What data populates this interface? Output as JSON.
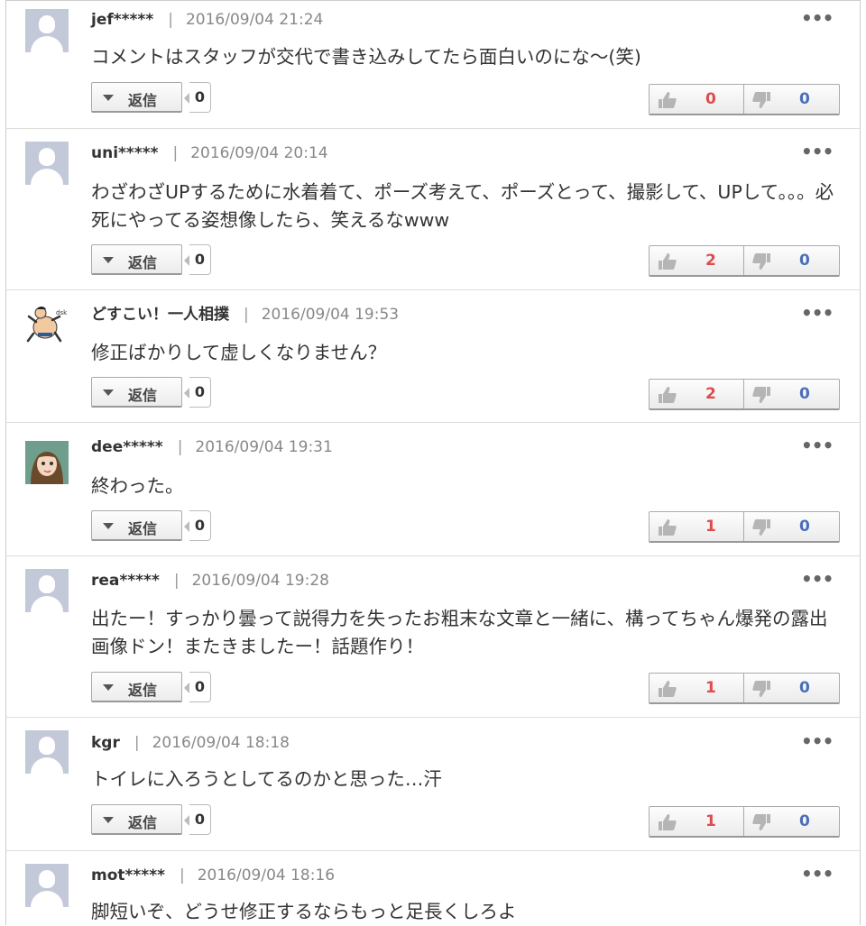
{
  "reply_label": "返信",
  "menu_label": "•••",
  "separator": "|",
  "colors": {
    "good": "#e04b4b",
    "bad": "#4a6fb8"
  },
  "comments": [
    {
      "name": "jef*****",
      "date": "2016/09/04 21:24",
      "avatar": "default-avatar-icon",
      "body": "コメントはスタッフが交代で書き込みしてたら面白いのにな～(笑)",
      "replies": "0",
      "good": "0",
      "bad": "0"
    },
    {
      "name": "uni*****",
      "date": "2016/09/04 20:14",
      "avatar": "default-avatar-icon",
      "body": "わざわざUPするために水着着て、ポーズ考えて、ポーズとって、撮影して、UPして。。。必死にやってる姿想像したら、笑えるなwww",
      "replies": "0",
      "good": "2",
      "bad": "0"
    },
    {
      "name": "どすこい！一人相撲",
      "date": "2016/09/04 19:53",
      "avatar": "sumo-avatar-icon",
      "body": "修正ばかりして虚しくなりません？",
      "replies": "0",
      "good": "2",
      "bad": "0"
    },
    {
      "name": "dee*****",
      "date": "2016/09/04 19:31",
      "avatar": "anime-avatar-icon",
      "body": "終わった。",
      "replies": "0",
      "good": "1",
      "bad": "0"
    },
    {
      "name": "rea*****",
      "date": "2016/09/04 19:28",
      "avatar": "default-avatar-icon",
      "body": "出たー！すっかり曇って説得力を失ったお粗末な文章と一緒に、構ってちゃん爆発の露出画像ドン！またきましたー！話題作り！",
      "replies": "0",
      "good": "1",
      "bad": "0"
    },
    {
      "name": "kgr",
      "date": "2016/09/04 18:18",
      "avatar": "default-avatar-icon",
      "body": "トイレに入ろうとしてるのかと思った…汗",
      "replies": "0",
      "good": "1",
      "bad": "0"
    },
    {
      "name": "mot*****",
      "date": "2016/09/04 18:16",
      "avatar": "default-avatar-icon",
      "body": "脚短いぞ、どうせ修正するならもっと足長くしろよ",
      "replies": "",
      "good": "",
      "bad": ""
    }
  ]
}
